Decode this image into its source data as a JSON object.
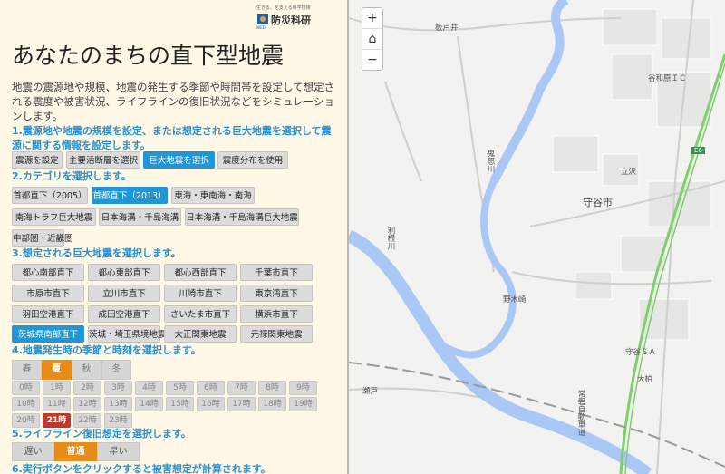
{
  "logo": {
    "tagline": "生きる、を支える科学技術",
    "name": "防災科研",
    "sub": "NIED"
  },
  "title": "あなたのまちの直下型地震",
  "description": "地震の震源地や規模、地震の発生する季節や時間帯を設定して想定される震度や被害状況、ライフラインの復旧状況などをシミュレーションします。",
  "steps": {
    "s1": "1.震源地や地震の規模を設定、または想定される巨大地震を選択して震源に関する情報を設定します。",
    "s2": "2.カテゴリを選択します。",
    "s3": "3.想定される巨大地震を選択します。",
    "s4": "4.地震発生時の季節と時刻を選択します。",
    "s5": "5.ライフライン復旧想定を選択します。",
    "s6": "6.実行ボタンをクリックすると被害想定が計算されます。"
  },
  "mode_buttons": [
    "震源を設定",
    "主要活断層を選択",
    "巨大地震を選択",
    "震度分布を使用"
  ],
  "category_buttons": [
    "首都直下（2005）",
    "首都直下（2013）",
    "東海・東南海・南海",
    "南海トラフ巨大地震",
    "日本海溝・千島海溝",
    "日本海溝・千島海溝巨大地震",
    "中部圏・近畿圏"
  ],
  "quake_buttons": [
    "都心南部直下",
    "都心東部直下",
    "都心西部直下",
    "千葉市直下",
    "市原市直下",
    "立川市直下",
    "川崎市直下",
    "東京湾直下",
    "羽田空港直下",
    "成田空港直下",
    "さいたま市直下",
    "横浜市直下",
    "茨城県南部直下",
    "茨城・埼玉県境地震",
    "大正関東地震",
    "元禄関東地震"
  ],
  "seasons": [
    "春",
    "夏",
    "秋",
    "冬"
  ],
  "hours": [
    "0時",
    "1時",
    "2時",
    "3時",
    "4時",
    "5時",
    "6時",
    "7時",
    "8時",
    "9時",
    "10時",
    "11時",
    "12時",
    "13時",
    "14時",
    "15時",
    "16時",
    "17時",
    "18時",
    "19時",
    "20時",
    "21時",
    "22時",
    "23時"
  ],
  "recovery": [
    "遅い",
    "普通",
    "早い"
  ],
  "selected": {
    "mode": "巨大地震を選択",
    "category": "首都直下（2013）",
    "quake": "茨城県南部直下",
    "season": "夏",
    "hour": "21時",
    "recovery": "普通"
  },
  "map": {
    "zoom_in": "+",
    "zoom_out": "−",
    "labels": [
      "板戸井",
      "守谷市",
      "立沢",
      "野木崎",
      "大柏",
      "谷和原ＩＣ",
      "E6",
      "鬼怒川",
      "利根川",
      "瀬戸",
      "常磐自動車道",
      "守谷ＳＡ"
    ]
  },
  "colors": {
    "accent_blue": "#1e96d8",
    "orange": "#e78b1a",
    "red": "#bb3a2e",
    "panel_bg": "#fff8e7",
    "river": "#a9c8f5"
  }
}
